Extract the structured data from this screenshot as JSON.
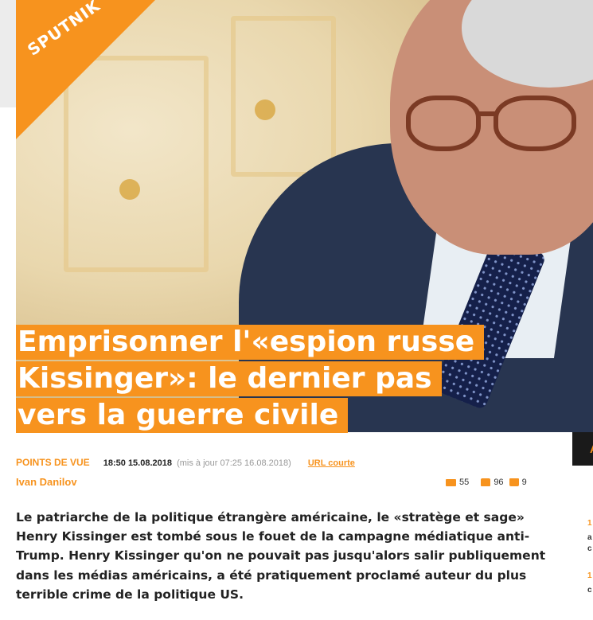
{
  "brand": {
    "logo_text": "SPUTNIK",
    "accent_color": "#f7931e"
  },
  "headline": {
    "lines": [
      "Emprisonner l'«espion russe",
      "Kissinger»: le dernier pas",
      "vers la guerre civile"
    ]
  },
  "meta": {
    "category": "POINTS DE VUE",
    "datetime": "18:50 15.08.2018",
    "updated": "(mis à jour 07:25 16.08.2018)",
    "short_url": "URL courte"
  },
  "author": "Ivan Danilov",
  "stats": {
    "comments": "55",
    "likes": "96",
    "dislikes": "9"
  },
  "lead": "Le patriarche de la politique étrangère américaine, le «stratège et sage» Henry Kissinger est tombé sous le fouet de la campagne médiatique anti-Trump. Henry Kissinger qu'on ne pouvait pas jusqu'alors salir publiquement dans les médias américains, a été pratiquement proclamé auteur du plus terrible crime de la politique US.",
  "sidebar": {
    "box_label": "A",
    "snippets": [
      "1",
      "a",
      "c",
      "1",
      "c"
    ]
  },
  "icons": {
    "comment": "comment-icon",
    "like": "thumbs-up-icon",
    "dislike": "thumbs-down-icon"
  }
}
